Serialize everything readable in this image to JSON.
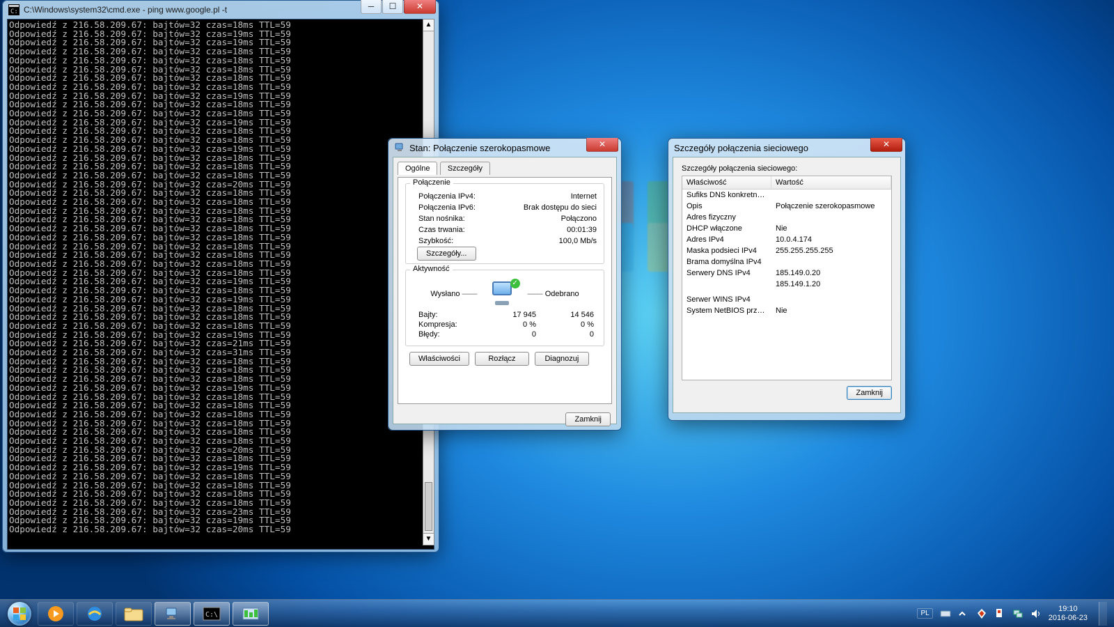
{
  "cmd": {
    "title": "C:\\Windows\\system32\\cmd.exe - ping  www.google.pl -t",
    "ip": "216.58.209.67",
    "bytes": "32",
    "ttl": "59",
    "prefix": "Odpowiedź z ",
    "mid1": ": bajtów=",
    "mid2": " czas=",
    "mid3": "ms TTL=",
    "times_ms": [
      "18",
      "19",
      "19",
      "18",
      "18",
      "18",
      "18",
      "18",
      "19",
      "18",
      "18",
      "19",
      "18",
      "18",
      "19",
      "18",
      "18",
      "18",
      "20",
      "18",
      "18",
      "18",
      "18",
      "18",
      "18",
      "18",
      "18",
      "18",
      "18",
      "19",
      "18",
      "19",
      "18",
      "18",
      "18",
      "19",
      "21",
      "31",
      "18",
      "18",
      "18",
      "19",
      "18",
      "18",
      "18",
      "18",
      "18",
      "18",
      "20",
      "18",
      "19",
      "18",
      "18",
      "18",
      "18",
      "23",
      "19",
      "20"
    ]
  },
  "status": {
    "title": "Stan: Połączenie szerokopasmowe",
    "tabs": {
      "general": "Ogólne",
      "details": "Szczegóły"
    },
    "grp_connection": "Połączenie",
    "rows": {
      "ipv4_l": "Połączenia IPv4:",
      "ipv4_v": "Internet",
      "ipv6_l": "Połączenia IPv6:",
      "ipv6_v": "Brak dostępu do sieci",
      "media_l": "Stan nośnika:",
      "media_v": "Połączono",
      "dur_l": "Czas trwania:",
      "dur_v": "00:01:39",
      "spd_l": "Szybkość:",
      "spd_v": "100,0 Mb/s"
    },
    "details_btn": "Szczegóły...",
    "grp_activity": "Aktywność",
    "sent": "Wysłano",
    "recv": "Odebrano",
    "bytes_l": "Bajty:",
    "bytes_sent": "17 945",
    "bytes_recv": "14 546",
    "comp_l": "Kompresja:",
    "comp_sent": "0 %",
    "comp_recv": "0 %",
    "err_l": "Błędy:",
    "err_sent": "0",
    "err_recv": "0",
    "btn_props": "Właściwości",
    "btn_disc": "Rozłącz",
    "btn_diag": "Diagnozuj",
    "btn_close": "Zamknij"
  },
  "details": {
    "title": "Szczegóły połączenia sieciowego",
    "heading": "Szczegóły połączenia sieciowego:",
    "col_prop": "Właściwość",
    "col_val": "Wartość",
    "rows": [
      {
        "p": "Sufiks DNS konkretneg...",
        "v": ""
      },
      {
        "p": "Opis",
        "v": "Połączenie szerokopasmowe"
      },
      {
        "p": "Adres fizyczny",
        "v": ""
      },
      {
        "p": "DHCP włączone",
        "v": "Nie"
      },
      {
        "p": "Adres IPv4",
        "v": "10.0.4.174"
      },
      {
        "p": "Maska podsieci IPv4",
        "v": "255.255.255.255"
      },
      {
        "p": "Brama domyślna IPv4",
        "v": ""
      },
      {
        "p": "Serwery DNS IPv4",
        "v": "185.149.0.20"
      },
      {
        "p": "",
        "v": "185.149.1.20"
      },
      {
        "p": "Serwer WINS IPv4",
        "v": ""
      },
      {
        "p": "System NetBIOS przez T...",
        "v": "Nie"
      }
    ],
    "btn_close": "Zamknij"
  },
  "taskbar": {
    "lang": "PL",
    "time": "19:10",
    "date": "2016-06-23"
  }
}
